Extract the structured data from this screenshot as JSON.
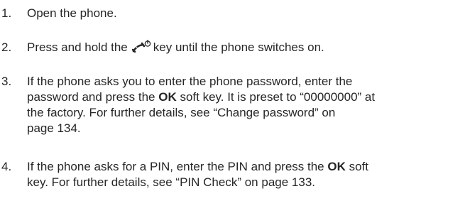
{
  "steps": [
    {
      "number": "1.",
      "text": "Open the phone."
    },
    {
      "number": "2.",
      "text_before": "Press and hold the",
      "icon": "power-end-key-icon",
      "text_after": "key until the phone switches on."
    },
    {
      "number": "3.",
      "l1": "If the phone asks you to enter the phone password, enter the",
      "l2a": "password and press the ",
      "l2b": "OK",
      "l2c": " soft key. It is preset to “00000000” at",
      "l3": "the factory. For further details, see “Change password” on",
      "l4": "page 134."
    },
    {
      "number": "4.",
      "l1a": "If the phone asks for a PIN, enter the PIN and press the ",
      "l1b": "OK",
      "l1c": " soft",
      "l2": "key. For further details, see “PIN Check” on page 133."
    }
  ]
}
